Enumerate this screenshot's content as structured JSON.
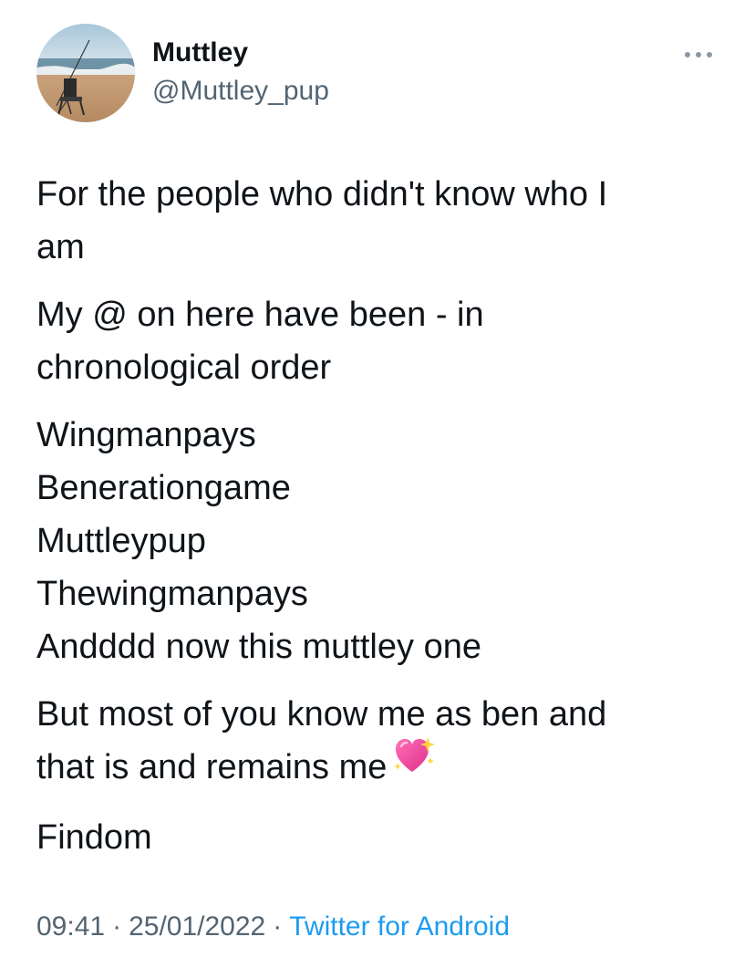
{
  "user": {
    "display_name": "Muttley",
    "handle": "@Muttley_pup",
    "avatar_icon": "beach-fishing-chair-avatar"
  },
  "more_icon": "more-horizontal-icon",
  "tweet": {
    "p1": [
      "For the people who didn't know who I",
      "am"
    ],
    "p2": [
      "My @ on here have been - in",
      "chronological order"
    ],
    "p3": [
      "Wingmanpays",
      "Benerationgame",
      "Muttleypup",
      "Thewingmanpays",
      "Andddd now this muttley one"
    ],
    "p4": [
      "But most of you know me as ben and",
      "that is and remains me"
    ],
    "p4_emoji": "sparkling-heart-emoji",
    "p5": [
      "Findom"
    ]
  },
  "meta": {
    "time": "09:41",
    "date": "25/01/2022",
    "separator": "·",
    "source": "Twitter for Android"
  },
  "colors": {
    "text": "#0f1419",
    "secondary": "#536471",
    "link": "#1d9bf0"
  }
}
